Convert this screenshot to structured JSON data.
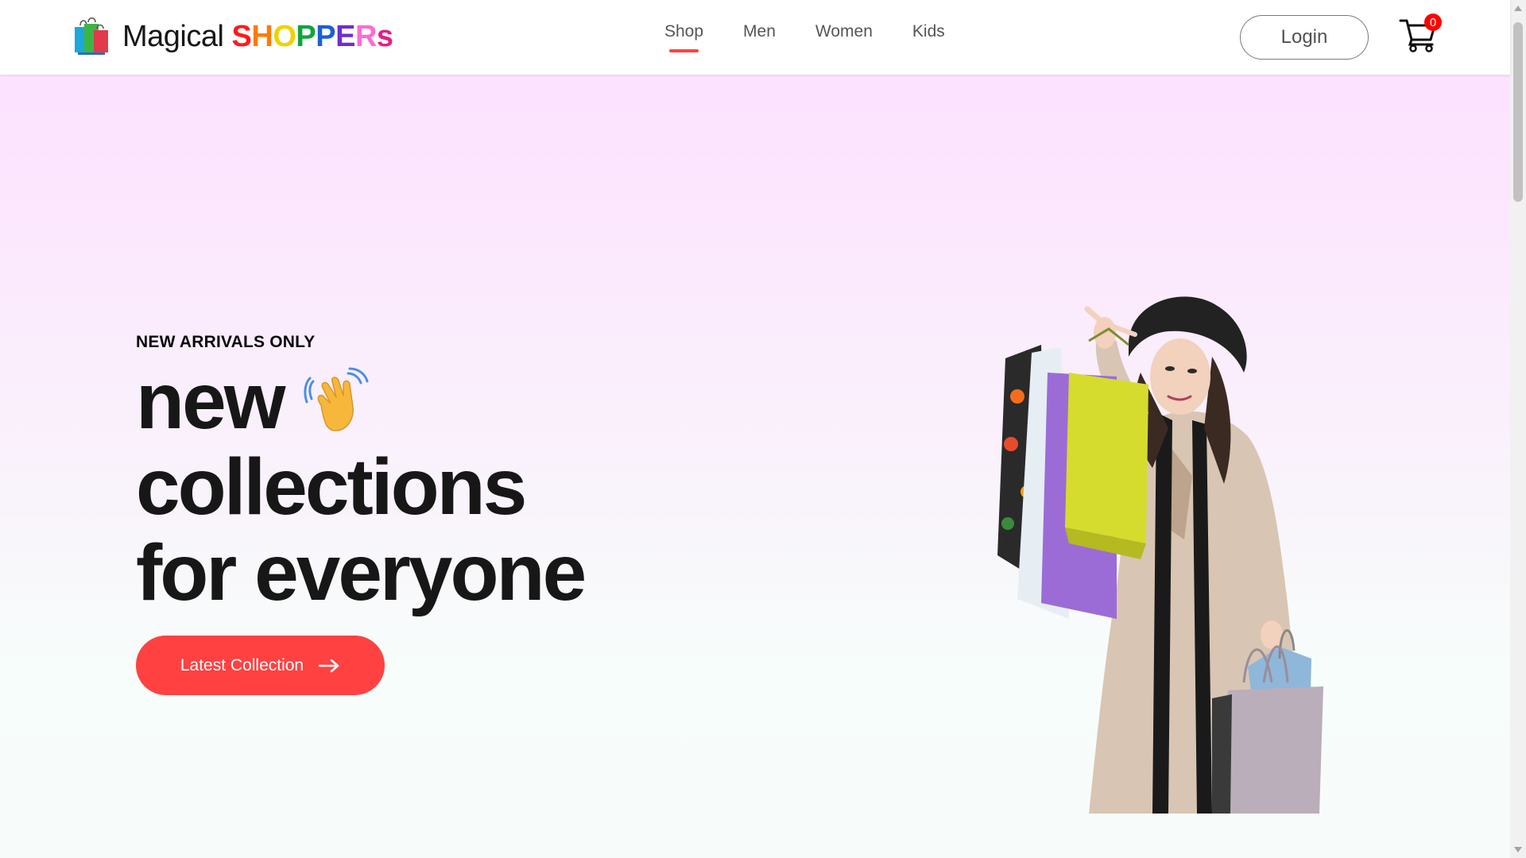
{
  "brand": {
    "name_prefix": "Magical",
    "name_accent_letters": [
      "S",
      "H",
      "O",
      "P",
      "P",
      "E",
      "R",
      "s"
    ],
    "accent_colors": [
      "#ff1a1a",
      "#ff7a00",
      "#f2d100",
      "#10a43a",
      "#1b5fd9",
      "#6f2bd6",
      "#ff6ad5",
      "#e0218a"
    ],
    "icon": "shopping-bags-icon"
  },
  "nav": {
    "items": [
      {
        "label": "Shop",
        "active": true
      },
      {
        "label": "Men",
        "active": false
      },
      {
        "label": "Women",
        "active": false
      },
      {
        "label": "Kids",
        "active": false
      }
    ],
    "underline_color": "#ff4141"
  },
  "header": {
    "login_label": "Login",
    "cart_icon": "cart-icon",
    "cart_count": "0"
  },
  "hero": {
    "kicker": "NEW ARRIVALS ONLY",
    "line1": "new",
    "line1_icon": "waving-hand-icon",
    "line2": "collections",
    "line3": "for everyone",
    "cta_label": "Latest Collection",
    "cta_icon": "arrow-right-icon",
    "cta_color": "#ff4141",
    "image": "woman-with-shopping-bags-image"
  }
}
